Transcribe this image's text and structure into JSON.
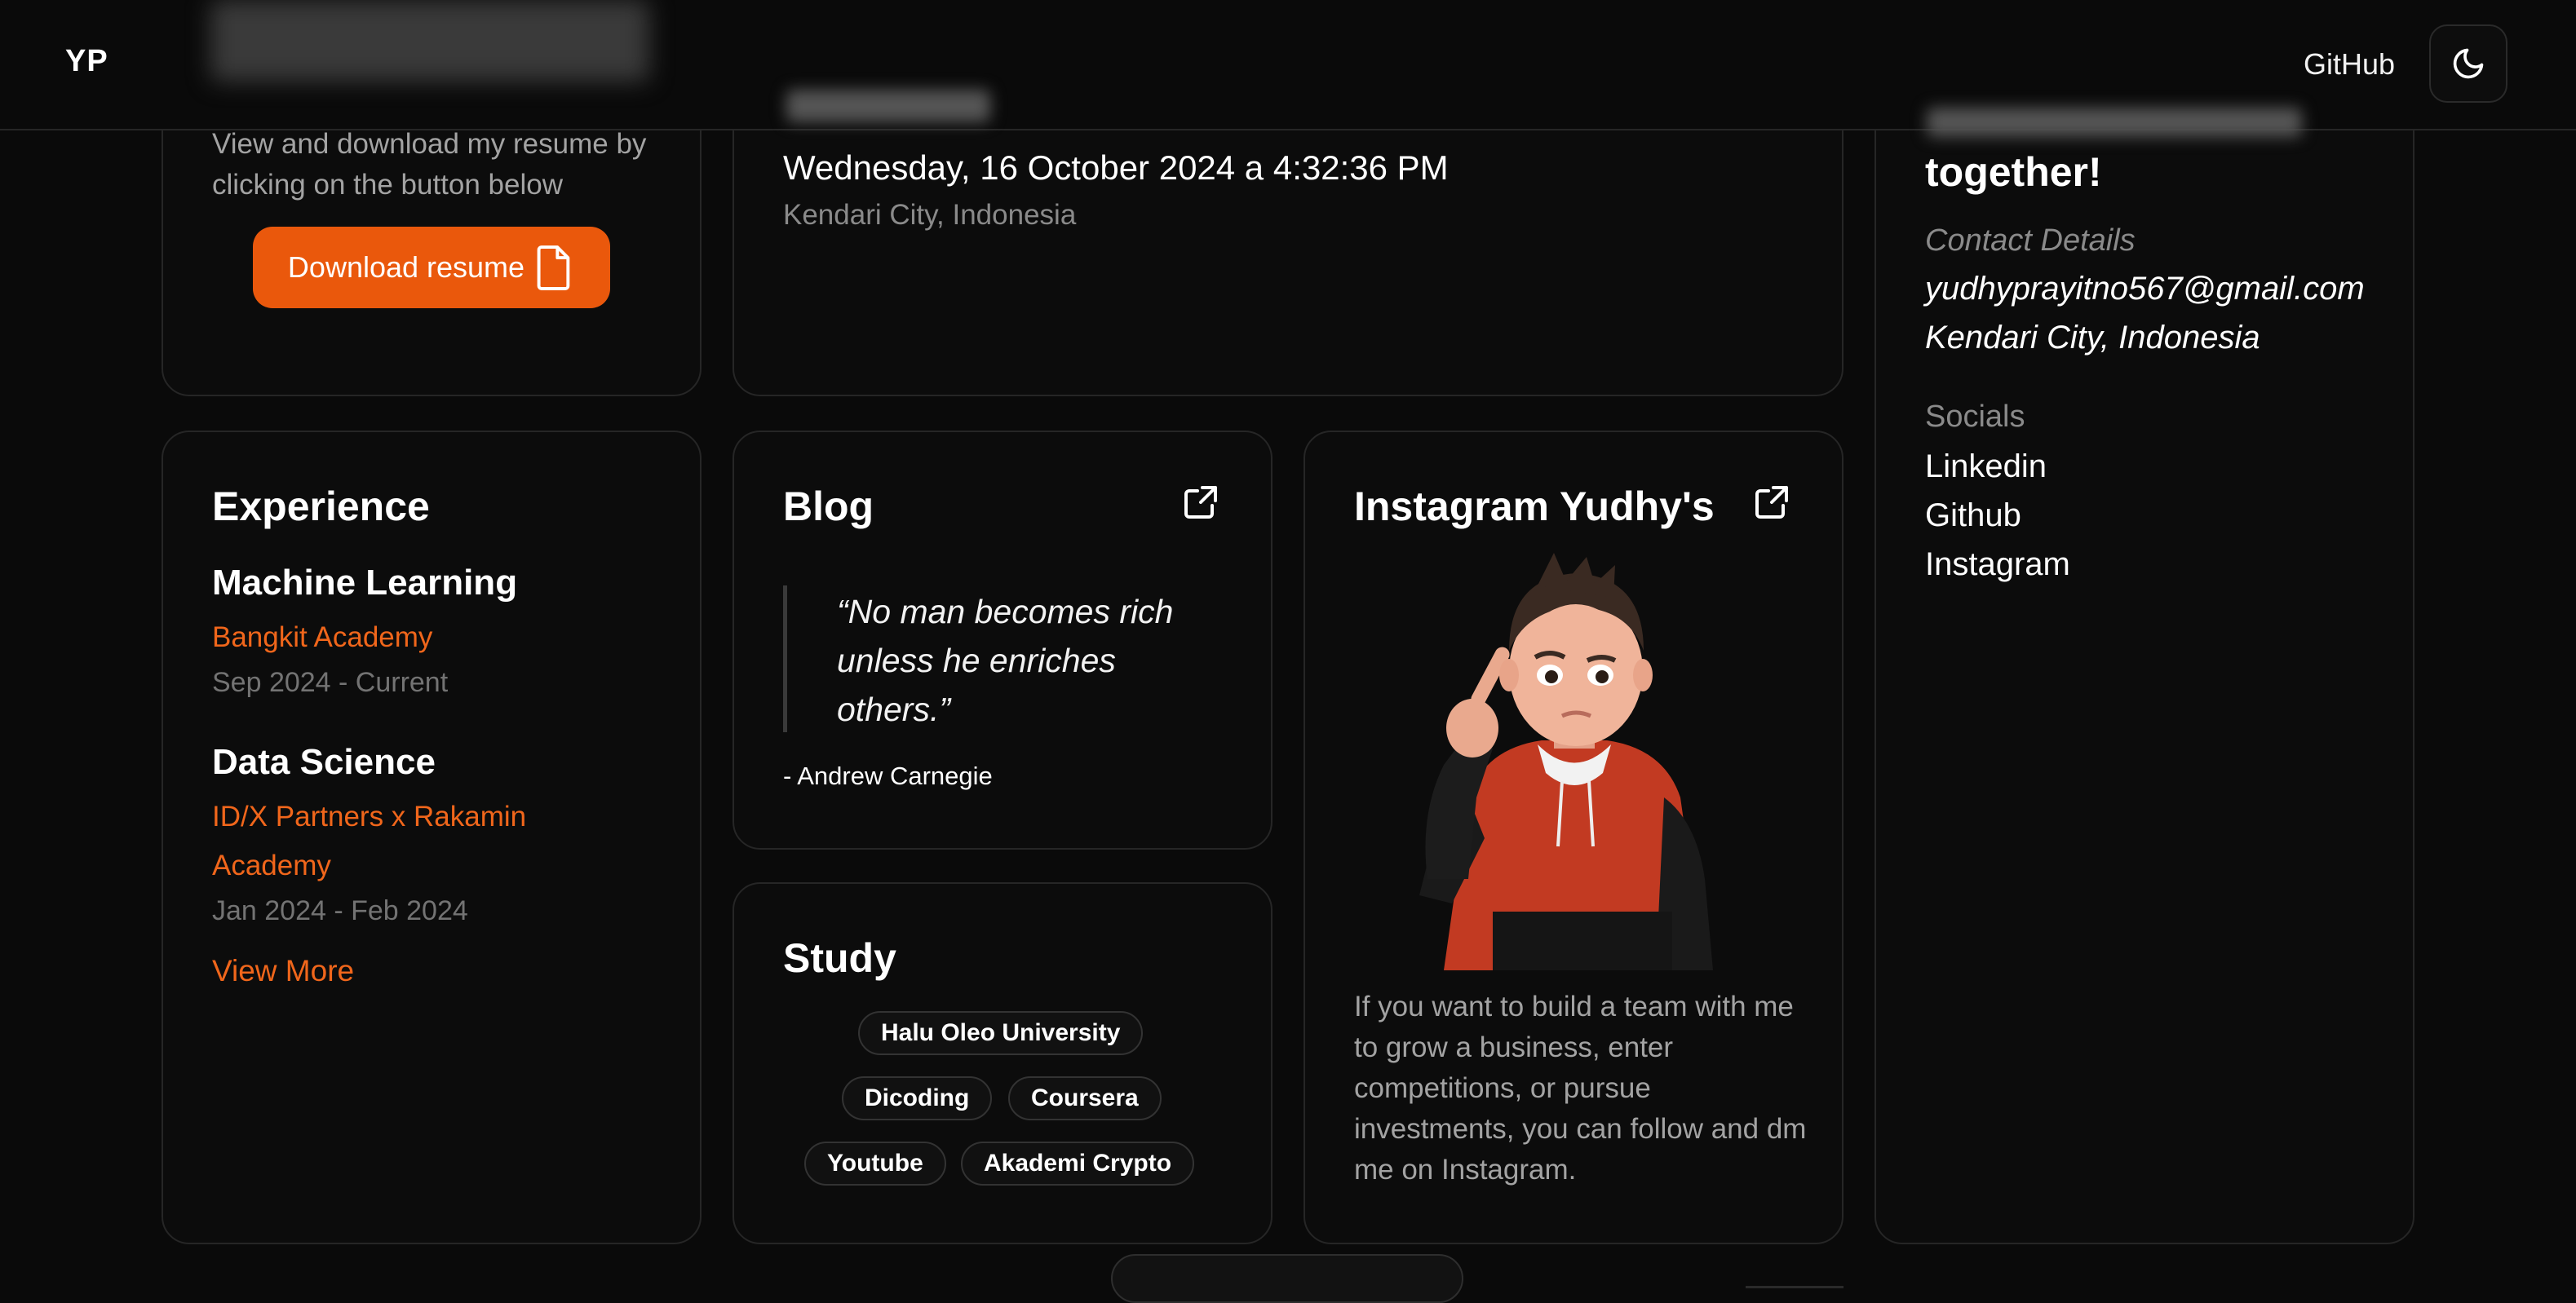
{
  "header": {
    "logo": "YP",
    "github_label": "GitHub",
    "theme_icon": "moon-icon"
  },
  "resume": {
    "description": "View and download my resume by clicking on the button below",
    "button_label": "Download resume",
    "button_icon": "file-icon"
  },
  "datetime": {
    "value": "Wednesday, 16 October 2024 a 4:32:36 PM",
    "location": "Kendari City, Indonesia"
  },
  "contact": {
    "title": "together!",
    "details_label": "Contact Details",
    "email": "yudhyprayitno567@gmail.com",
    "location": "Kendari City, Indonesia",
    "socials_label": "Socials",
    "socials": [
      "Linkedin",
      "Github",
      "Instagram"
    ]
  },
  "experience": {
    "title": "Experience",
    "items": [
      {
        "role": "Machine Learning",
        "org": "Bangkit Academy",
        "date": "Sep 2024 - Current"
      },
      {
        "role": "Data Science",
        "org": "ID/X Partners x Rakamin Academy",
        "date": "Jan 2024 - Feb 2024"
      }
    ],
    "view_more": "View More"
  },
  "blog": {
    "title": "Blog",
    "quote": "“No man becomes rich unless he enriches others.”",
    "author": "- Andrew Carnegie",
    "link_icon": "external-link-icon"
  },
  "study": {
    "title": "Study",
    "tags": [
      "Halu Oleo University",
      "Dicoding",
      "Coursera",
      "Youtube",
      "Akademi Crypto"
    ]
  },
  "instagram": {
    "title": "Instagram Yudhy's",
    "link_icon": "external-link-icon",
    "description": "If you want to build a team with me to grow a business, enter competitions, or pursue investments, you can follow and dm me on Instagram."
  },
  "colors": {
    "accent": "#ea580c",
    "accent_text": "#f0661b",
    "background": "#0a0a0a",
    "card_border": "#262626"
  }
}
